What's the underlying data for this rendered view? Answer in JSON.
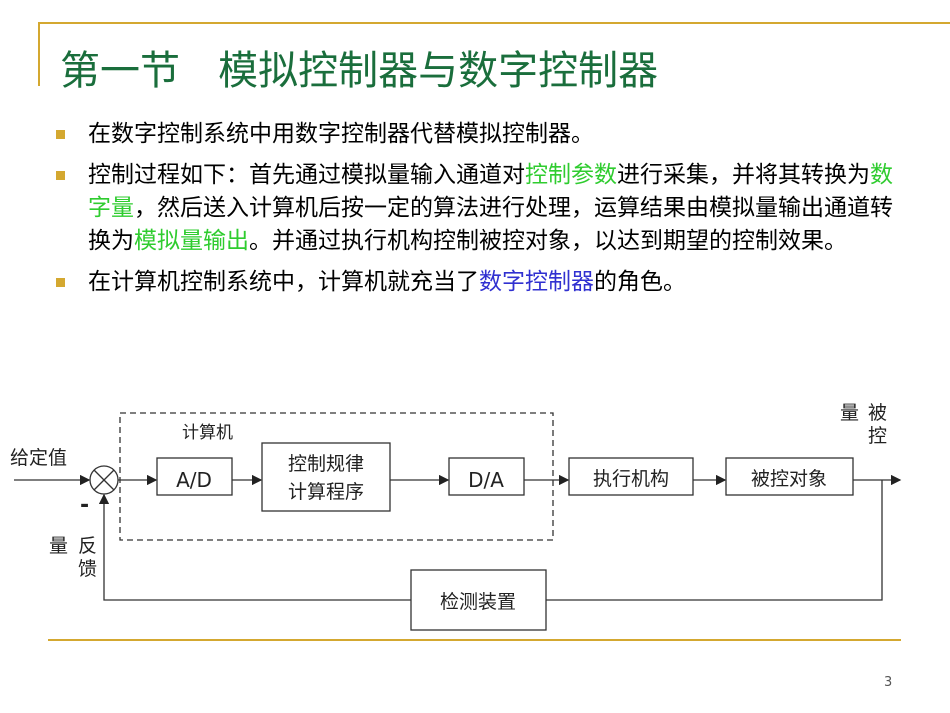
{
  "title": "第一节   模拟控制器与数字控制器",
  "bullets": [
    {
      "parts": [
        "在数字控制系统中用数字控制器代替模拟控制器。"
      ]
    },
    {
      "parts": [
        "控制过程如下：首先通过模拟量输入通道对",
        "控制参数",
        "进行采集，并将其转换为",
        "数字量",
        "，然后送入计算机后按一定的算法进行处理，运算结果由模拟量输出通道转换为",
        "模拟量输出",
        "。并通过执行机构控制被控对象，以达到期望的控制效果。"
      ]
    },
    {
      "parts": [
        "在计算机控制系统中，计算机就充当了",
        "数字控制器",
        "的角色。"
      ]
    }
  ],
  "diagram": {
    "setpoint": "给定值",
    "computer": "计算机",
    "ad": "A/D",
    "algo1": "控制规律",
    "algo2": "计算程序",
    "da": "D/A",
    "actuator": "执行机构",
    "plant": "被控对象",
    "sensor": "检测装置",
    "minus": "-",
    "output_a": "被",
    "output_b": "控",
    "output_c": "量",
    "feedback_a": "反",
    "feedback_b": "馈",
    "feedback_c": "量"
  },
  "colors": {
    "accent": "#d4a830",
    "title": "#1a6e3c",
    "green": "#2fcc2f",
    "blue": "#3030d0"
  },
  "page_number": "3"
}
